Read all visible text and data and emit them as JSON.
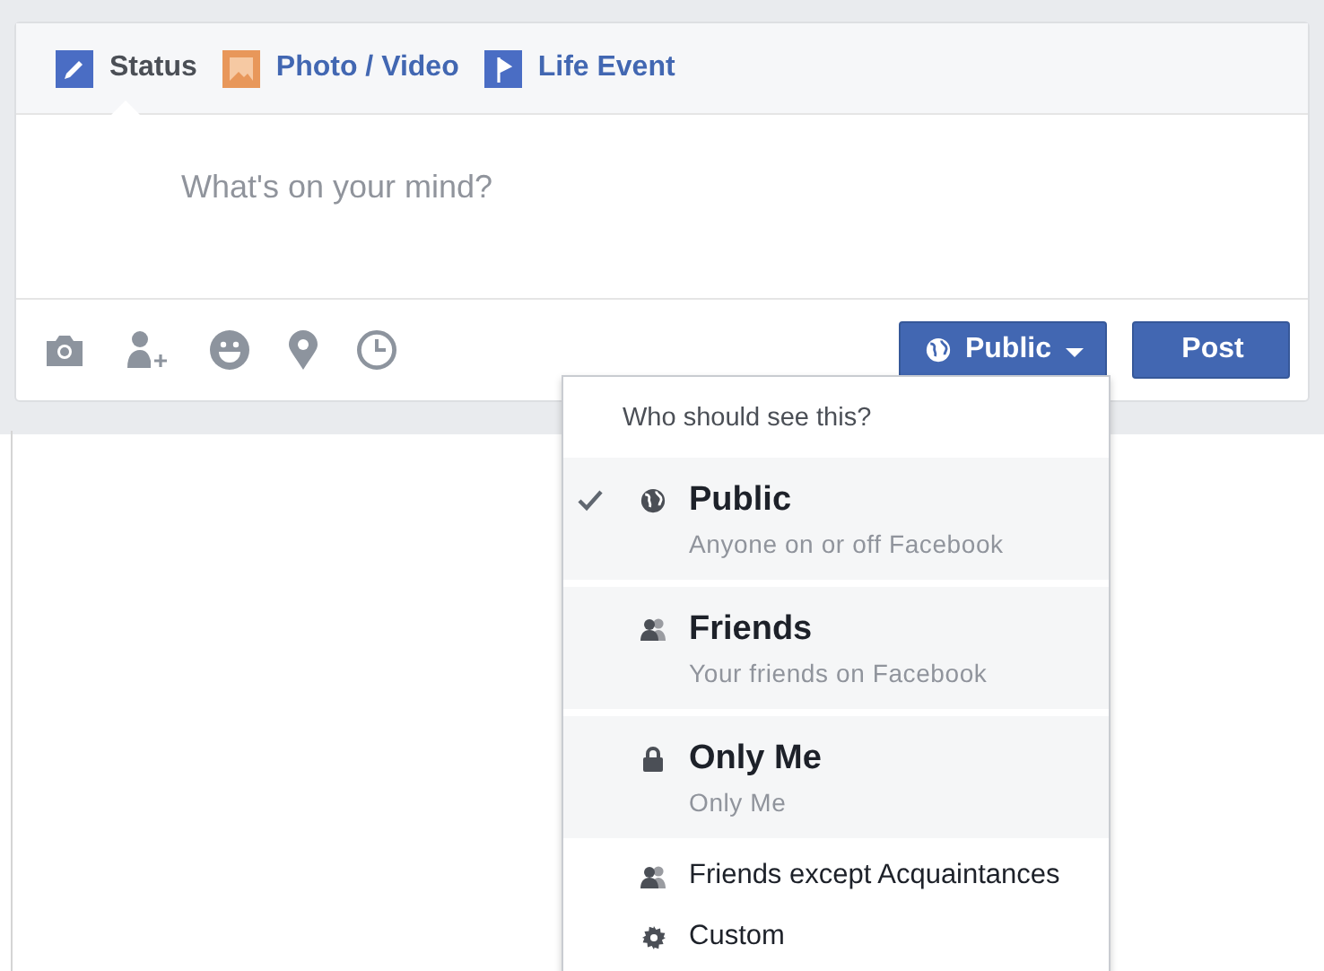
{
  "composer": {
    "tabs": [
      {
        "label": "Status",
        "selected": true
      },
      {
        "label": "Photo / Video",
        "selected": false
      },
      {
        "label": "Life Event",
        "selected": false
      }
    ],
    "placeholder": "What's on your mind?",
    "audience_button": "Public",
    "post_button": "Post"
  },
  "audience_menu": {
    "heading": "Who should see this?",
    "options": [
      {
        "kind": "large",
        "title": "Public",
        "subtitle": "Anyone on or off Facebook",
        "selected": true
      },
      {
        "kind": "large",
        "title": "Friends",
        "subtitle": "Your friends on Facebook",
        "selected": false
      },
      {
        "kind": "large",
        "title": "Only Me",
        "subtitle": "Only Me",
        "selected": false
      },
      {
        "kind": "small",
        "title": "Friends except Acquaintances",
        "selected": false
      },
      {
        "kind": "small",
        "title": "Custom",
        "selected": false
      }
    ]
  }
}
